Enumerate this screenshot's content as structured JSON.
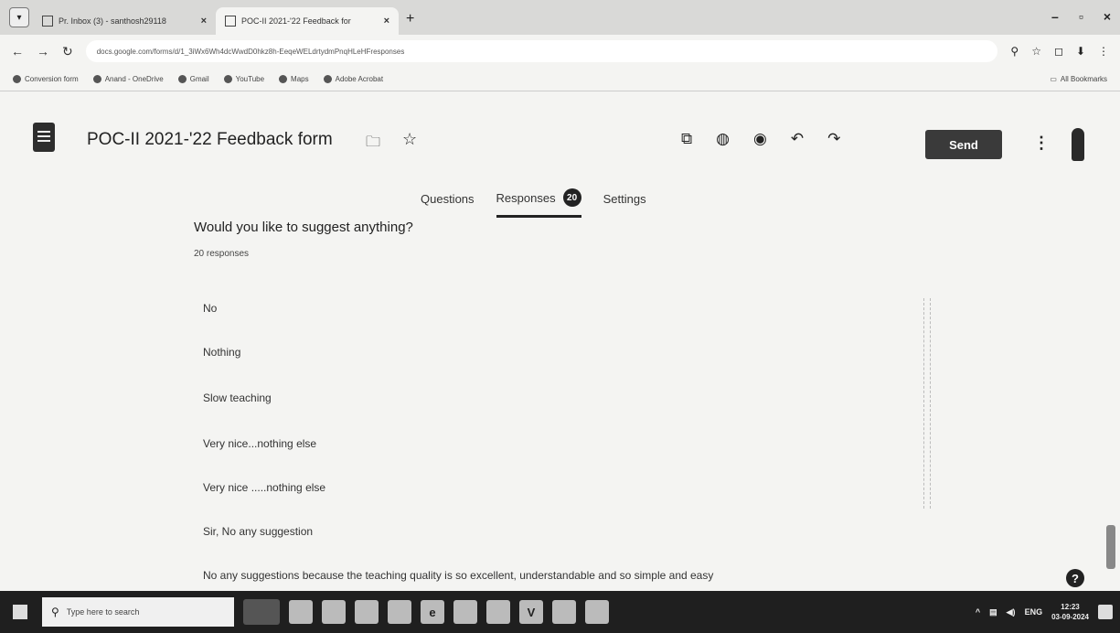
{
  "browser": {
    "tabs": [
      {
        "title": "Pr. Inbox (3) - santhosh29118",
        "active": false
      },
      {
        "title": "POC-II 2021-'22 Feedback for",
        "active": true
      }
    ],
    "url": "docs.google.com/forms/d/1_3iWx6Wh4dcWwdD0hkz8h-EeqeWELdrtydmPnqHLeHFresponses",
    "bookmarks": [
      "Conversion form",
      "Anand - OneDrive",
      "Gmail",
      "YouTube",
      "Maps",
      "Adobe Acrobat"
    ],
    "all_bookmarks": "All Bookmarks"
  },
  "form": {
    "title": "POC-II 2021-'22 Feedback form",
    "send_label": "Send",
    "tabs": [
      {
        "label": "Questions"
      },
      {
        "label": "Responses",
        "badge": "20"
      },
      {
        "label": "Settings"
      }
    ],
    "icons": [
      "add-on-icon",
      "palette-icon",
      "preview-eye-icon",
      "undo-icon",
      "redo-icon"
    ]
  },
  "question": {
    "title": "Would you like to suggest anything?",
    "response_count": "20 responses",
    "answers": [
      "No",
      "Nothing",
      "Slow teaching",
      "Very nice...nothing else",
      "Very nice .....nothing else",
      "Sir, No any suggestion",
      "No any suggestions because the teaching quality is so excellent, understandable and so simple and easy"
    ]
  },
  "taskbar": {
    "search_placeholder": "Type here to search",
    "apps": [
      "",
      "",
      "",
      "",
      "e",
      "",
      "",
      "V",
      "",
      ""
    ],
    "tray_lang": "ENG",
    "time": "12:23",
    "date": "03-09-2024"
  }
}
